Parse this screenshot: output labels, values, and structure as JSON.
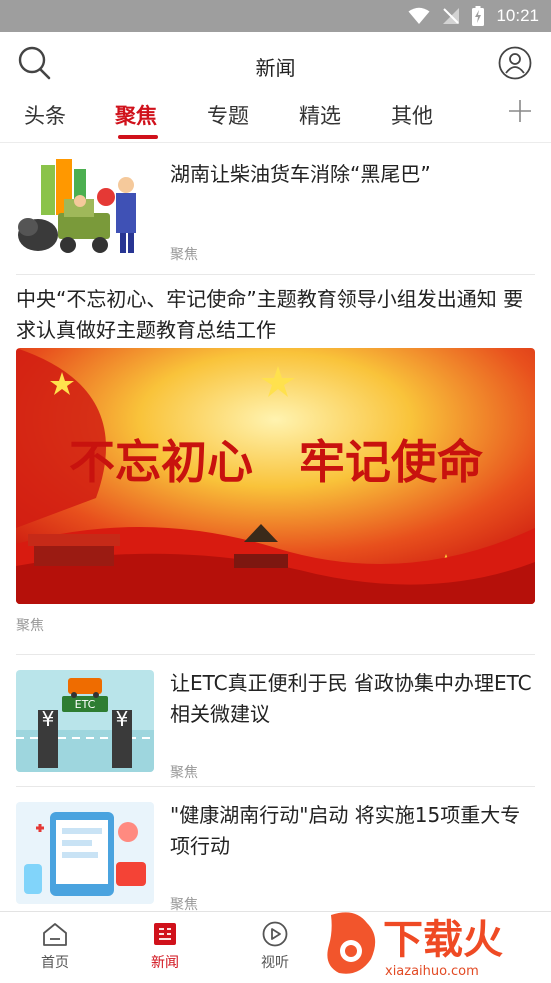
{
  "status_bar": {
    "time": "10:21"
  },
  "header": {
    "title": "新闻"
  },
  "tabs": [
    {
      "label": "头条"
    },
    {
      "label": "聚焦"
    },
    {
      "label": "专题"
    },
    {
      "label": "精选"
    },
    {
      "label": "其他"
    }
  ],
  "active_tab": "聚焦",
  "feed": [
    {
      "title": "湖南让柴油货车消除“黑尾巴”",
      "tag": "聚焦"
    },
    {
      "title": "中央“不忘初心、牢记使命”主题教育领导小组发出通知 要求认真做好主题教育总结工作",
      "tag": "聚焦",
      "banner_text": "不忘初心　牢记使命"
    },
    {
      "title": "让ETC真正便利于民 省政协集中办理ETC相关微建议",
      "tag": "聚焦",
      "thumb_text": "ETC"
    },
    {
      "title": "\"健康湖南行动\"启动 将实施15项重大专项行动",
      "tag": "聚焦"
    }
  ],
  "bottom_nav": [
    {
      "label": "首页"
    },
    {
      "label": "新闻"
    },
    {
      "label": "视听"
    }
  ],
  "watermark": {
    "brand": "下载火",
    "url": "xiazaihuo.com"
  },
  "colors": {
    "accent": "#d0111b",
    "status_bar": "#9e9e9e",
    "tag": "#999999",
    "text": "#222222"
  }
}
